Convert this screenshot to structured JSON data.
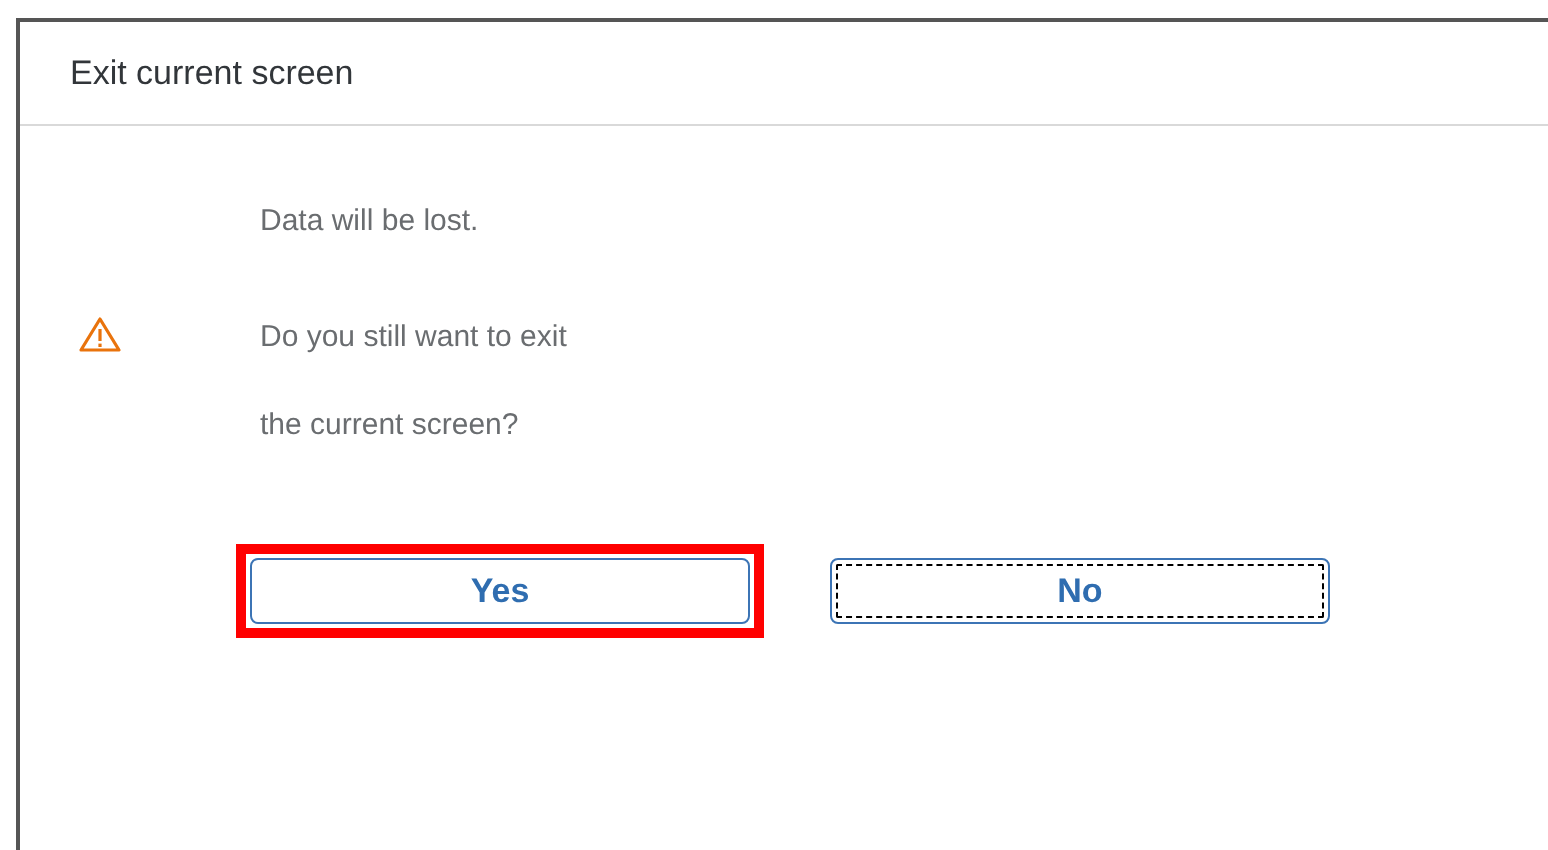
{
  "dialog": {
    "title": "Exit current screen",
    "info": "Data will be lost.",
    "warning": {
      "kind": "warning",
      "lines": [
        "Do you still want to exit",
        "the current screen?"
      ]
    },
    "buttons": [
      {
        "label": "Yes",
        "highlighted": true,
        "focused": false
      },
      {
        "label": "No",
        "highlighted": false,
        "focused": true
      }
    ]
  }
}
